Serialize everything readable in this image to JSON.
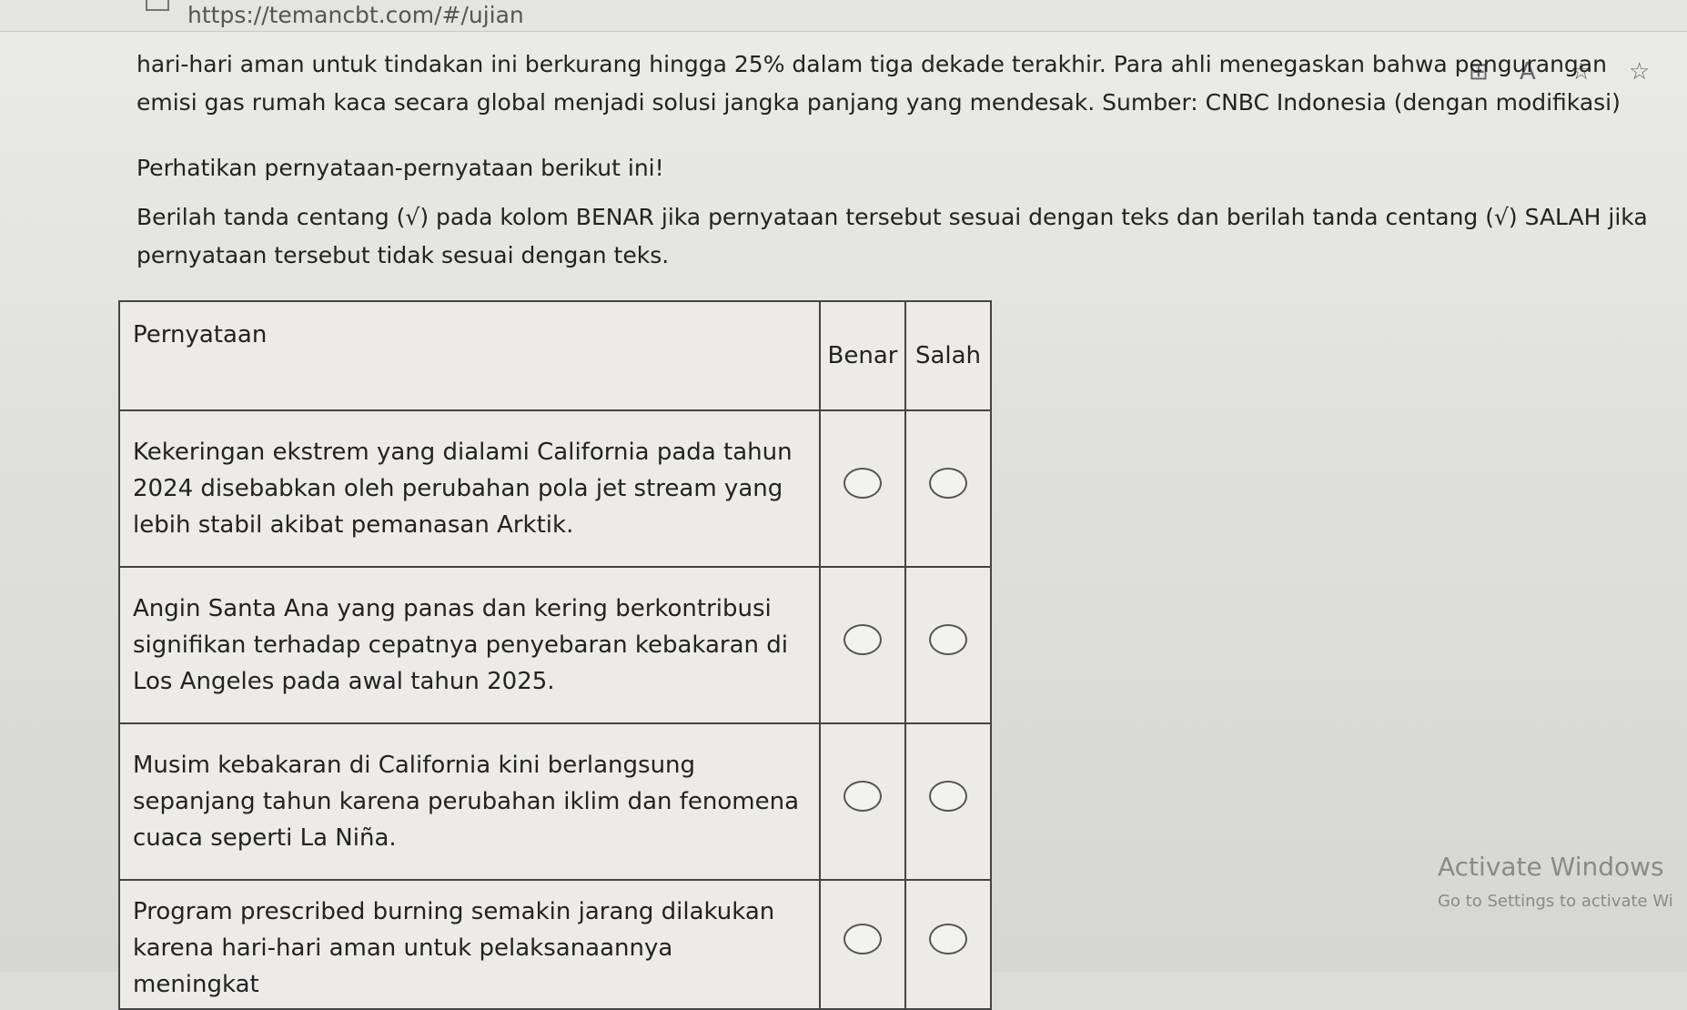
{
  "browser": {
    "url": "https://temancbt.com/#/ujian",
    "icons": [
      "reader-view-icon",
      "read-aloud-icon",
      "favorite-star-icon",
      "favorites-list-icon"
    ]
  },
  "passage": {
    "text": "hari-hari aman untuk tindakan ini berkurang hingga 25% dalam tiga dekade terakhir. Para ahli menegaskan bahwa pengurangan emisi gas rumah kaca secara global menjadi solusi jangka panjang yang mendesak. Sumber: CNBC Indonesia (dengan modifikasi)"
  },
  "instruction": {
    "intro": "Perhatikan pernyataan-pernyataan berikut ini!",
    "task": "Berilah tanda centang (√) pada kolom BENAR jika pernyataan tersebut sesuai dengan teks dan berilah tanda centang (√) SALAH jika pernyataan tersebut tidak sesuai dengan teks."
  },
  "table": {
    "headers": {
      "statement": "Pernyataan",
      "true": "Benar",
      "false": "Salah"
    },
    "rows": [
      {
        "statement": "Kekeringan ekstrem yang dialami California pada tahun 2024 disebabkan oleh perubahan pola jet stream yang lebih stabil akibat pemanasan Arktik."
      },
      {
        "statement": "Angin Santa Ana yang panas dan kering berkontribusi signifikan terhadap cepatnya penyebaran kebakaran di Los Angeles pada awal tahun 2025."
      },
      {
        "statement": "Musim kebakaran di California kini berlangsung sepanjang tahun karena perubahan iklim dan fenomena cuaca seperti La Niña."
      },
      {
        "statement": "Program prescribed burning semakin jarang dilakukan karena hari-hari aman untuk pelaksanaannya meningkat"
      }
    ]
  },
  "watermark": {
    "title": "Activate Windows",
    "subtitle": "Go to Settings to activate Wi"
  }
}
